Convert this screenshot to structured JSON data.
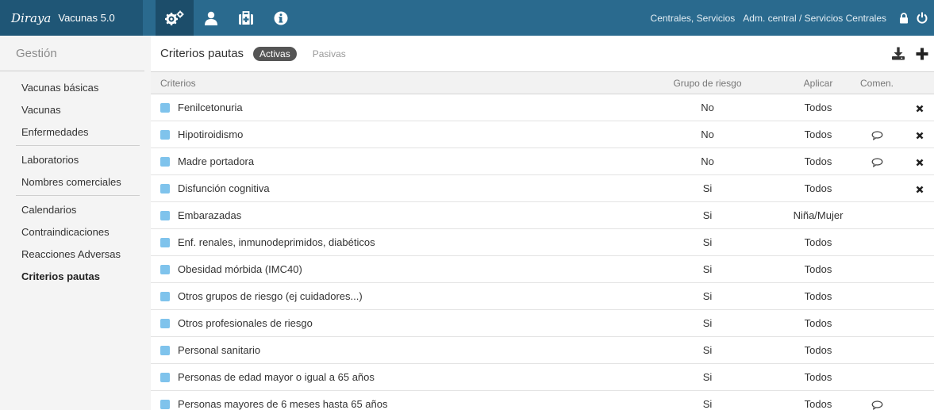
{
  "header": {
    "logo_text": "Diraya",
    "app_title": "Vacunas 5.0",
    "nav_icons": [
      "gears-icon",
      "user-icon",
      "medical-kit-icon",
      "info-icon"
    ],
    "crumb_center": "Centrales, Servicios",
    "crumb_unit": "Adm. central / Servicios Centrales",
    "right_icons": [
      "lock-icon",
      "power-icon"
    ]
  },
  "sidebar": {
    "title": "Gestión",
    "groups": [
      [
        "Vacunas básicas",
        "Vacunas",
        "Enfermedades"
      ],
      [
        "Laboratorios",
        "Nombres comerciales"
      ],
      [
        "Calendarios",
        "Contraindicaciones",
        "Reacciones Adversas",
        "Criterios pautas"
      ]
    ],
    "active_item": "Criterios pautas"
  },
  "main": {
    "title": "Criterios pautas",
    "tab_active": "Activas",
    "tab_inactive": "Pasivas",
    "actions": [
      "download-icon",
      "plus-icon"
    ],
    "columns": {
      "criterio": "Criterios",
      "grupo": "Grupo de riesgo",
      "aplicar": "Aplicar",
      "comen": "Comen."
    },
    "rows": [
      {
        "criterio": "Fenilcetonuria",
        "grupo": "No",
        "aplicar": "Todos",
        "comment": false,
        "delete": true
      },
      {
        "criterio": "Hipotiroidismo",
        "grupo": "No",
        "aplicar": "Todos",
        "comment": true,
        "delete": true
      },
      {
        "criterio": "Madre portadora",
        "grupo": "No",
        "aplicar": "Todos",
        "comment": true,
        "delete": true
      },
      {
        "criterio": "Disfunción cognitiva",
        "grupo": "Si",
        "aplicar": "Todos",
        "comment": false,
        "delete": true
      },
      {
        "criterio": "Embarazadas",
        "grupo": "Si",
        "aplicar": "Niña/Mujer",
        "comment": false,
        "delete": false
      },
      {
        "criterio": "Enf. renales, inmunodeprimidos, diabéticos",
        "grupo": "Si",
        "aplicar": "Todos",
        "comment": false,
        "delete": false
      },
      {
        "criterio": "Obesidad mórbida (IMC40)",
        "grupo": "Si",
        "aplicar": "Todos",
        "comment": false,
        "delete": false
      },
      {
        "criterio": "Otros grupos de riesgo (ej cuidadores...)",
        "grupo": "Si",
        "aplicar": "Todos",
        "comment": false,
        "delete": false
      },
      {
        "criterio": "Otros profesionales de riesgo",
        "grupo": "Si",
        "aplicar": "Todos",
        "comment": false,
        "delete": false
      },
      {
        "criterio": "Personal sanitario",
        "grupo": "Si",
        "aplicar": "Todos",
        "comment": false,
        "delete": false
      },
      {
        "criterio": "Personas de edad mayor o igual a 65 años",
        "grupo": "Si",
        "aplicar": "Todos",
        "comment": false,
        "delete": false
      },
      {
        "criterio": "Personas mayores de 6 meses hasta 65 años",
        "grupo": "Si",
        "aplicar": "Todos",
        "comment": true,
        "delete": false
      }
    ]
  },
  "colors": {
    "topbar": "#2a6a8e",
    "brand": "#1f5676",
    "criterion_marker": "#7fc3ec",
    "active_pill": "#555555"
  }
}
